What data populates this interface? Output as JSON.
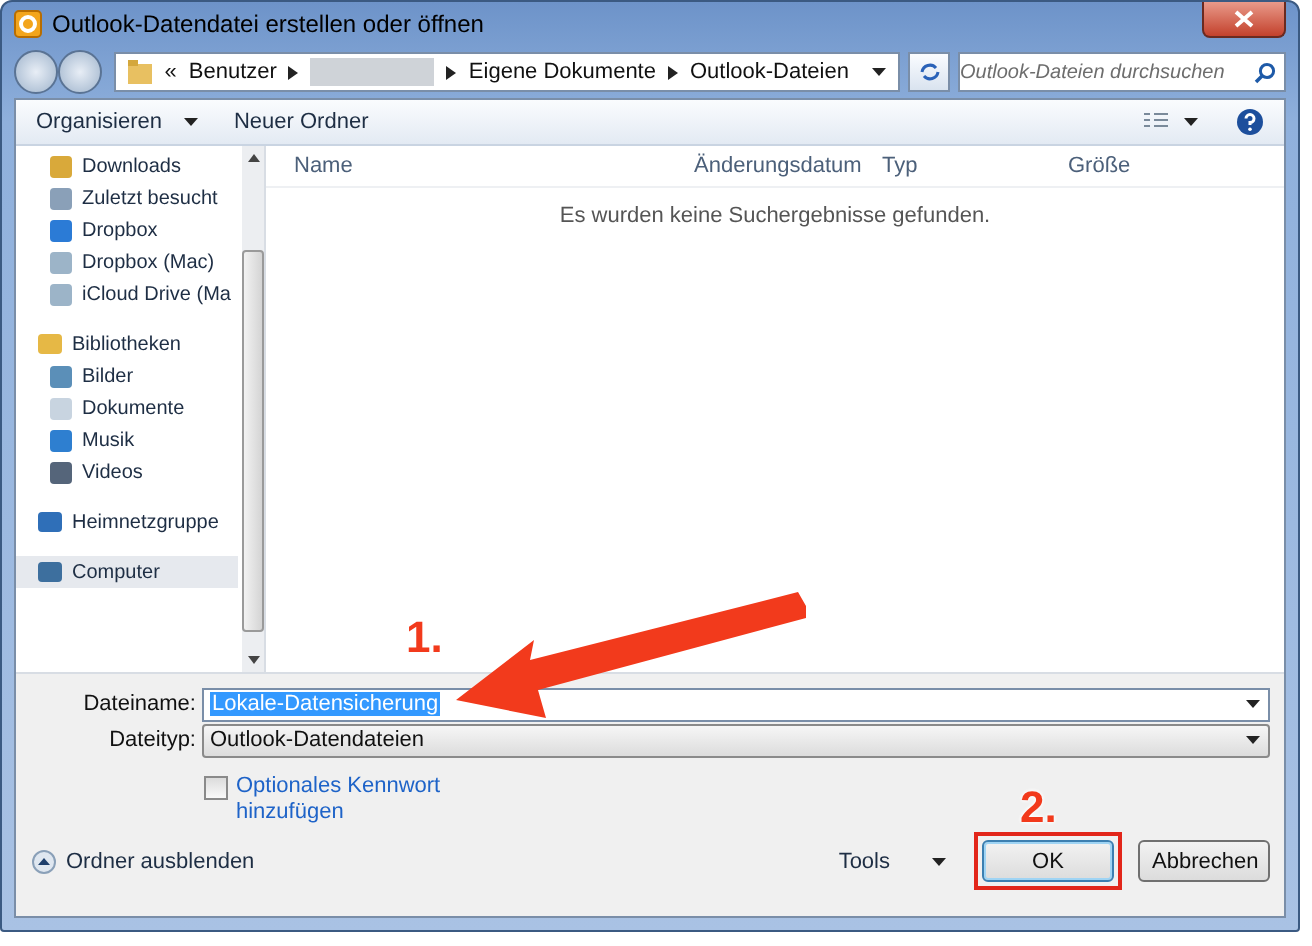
{
  "window": {
    "title": "Outlook-Datendatei erstellen oder öffnen"
  },
  "address_bar": {
    "crumbs": [
      {
        "kind": "text",
        "label": "«"
      },
      {
        "kind": "text",
        "label": "Benutzer"
      },
      {
        "kind": "hidden"
      },
      {
        "kind": "text",
        "label": "Eigene Dokumente"
      },
      {
        "kind": "text",
        "label": "Outlook-Dateien"
      }
    ]
  },
  "search": {
    "placeholder": "Outlook-Dateien durchsuchen"
  },
  "toolbar": {
    "buttons": [
      {
        "label": "Organisieren",
        "dropdown": true
      },
      {
        "label": "Neuer Ordner",
        "dropdown": false
      }
    ]
  },
  "nav": [
    {
      "children": [
        {
          "label": "Downloads",
          "selected": false
        },
        {
          "label": "Zuletzt besucht",
          "selected": false
        },
        {
          "label": "Dropbox",
          "selected": false
        },
        {
          "label": "Dropbox (Mac)",
          "selected": false
        },
        {
          "label": "iCloud Drive (Ma",
          "selected": false
        }
      ]
    },
    {
      "label": "Bibliotheken",
      "selected": false,
      "children": [
        {
          "label": "Bilder",
          "selected": false
        },
        {
          "label": "Dokumente",
          "selected": false
        },
        {
          "label": "Musik",
          "selected": false
        },
        {
          "label": "Videos",
          "selected": false
        }
      ]
    },
    {
      "label": "Heimnetzgruppe",
      "selected": false
    },
    {
      "label": "Computer",
      "selected": true
    }
  ],
  "table": {
    "columns": [
      "Name",
      "Änderungsdatum",
      "Typ",
      "Größe"
    ],
    "empty_message": "Es wurden keine Suchergebnisse gefunden."
  },
  "form": {
    "filename_label": "Dateiname:",
    "filename": "Lokale-Datensicherung",
    "filetype_label": "Dateityp:",
    "filetype": "Outlook-Datendateien",
    "password": {
      "label": "Optionales Kennwort hinzufügen",
      "checked": false
    }
  },
  "footer": {
    "hide_folders": "Ordner ausblenden",
    "tools": "Tools",
    "ok": "OK",
    "cancel": "Abbrechen"
  },
  "annotations": [
    {
      "label": "1.",
      "kind": "arrow"
    },
    {
      "label": "2.",
      "kind": "box"
    }
  ]
}
